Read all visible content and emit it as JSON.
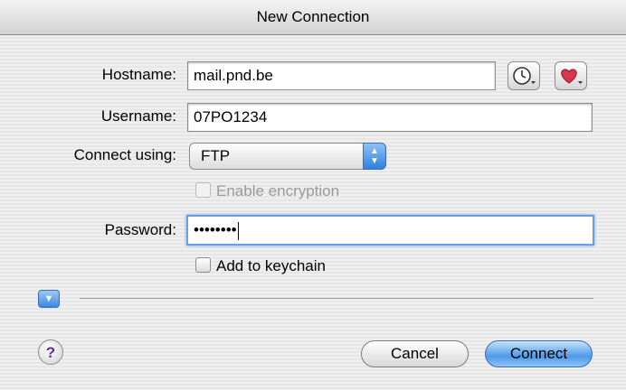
{
  "window": {
    "title": "New Connection"
  },
  "form": {
    "hostname_label": "Hostname:",
    "hostname_value": "mail.pnd.be",
    "username_label": "Username:",
    "username_value": "07PO1234",
    "connect_using_label": "Connect using:",
    "connect_using_value": "FTP",
    "enable_encryption_label": "Enable encryption",
    "password_label": "Password:",
    "password_value": "••••••••",
    "add_to_keychain_label": "Add to keychain"
  },
  "icons": {
    "history": "clock-icon",
    "bookmarks": "heart-icon",
    "disclosure": "chevron-down-icon",
    "help": "question-icon"
  },
  "buttons": {
    "help_label": "?",
    "cancel_label": "Cancel",
    "connect_label": "Connect"
  },
  "colors": {
    "accent": "#3a86e2",
    "focus_ring": "#6d9ee0",
    "heart": "#d9364c"
  }
}
